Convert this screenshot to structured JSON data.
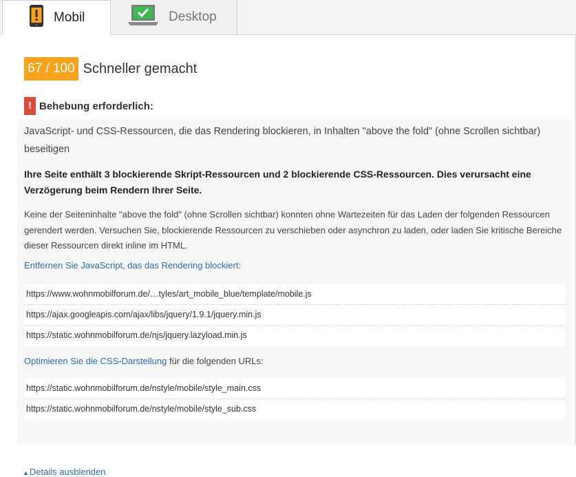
{
  "tabs": [
    {
      "label": "Mobil",
      "icon": "phone-warning-icon",
      "active": true
    },
    {
      "label": "Desktop",
      "icon": "laptop-check-icon",
      "active": false
    }
  ],
  "score": {
    "value": "67 / 100",
    "label": "Schneller gemacht",
    "color": "#f9a21c"
  },
  "fix": {
    "icon": "!",
    "title": "Behebung erforderlich:",
    "color": "#dd4b39"
  },
  "rule": {
    "title": "JavaScript- und CSS-Ressourcen, die das Rendering blockieren, in Inhalten \"above the fold\" (ohne Scrollen sichtbar) beseitigen",
    "summary": "Ihre Seite enthält 3 blockierende Skript-Ressourcen und 2 blockierende CSS-Ressourcen. Dies verursacht eine Verzögerung beim Rendern Ihrer Seite.",
    "description": "Keine der Seiteninhalte \"above the fold\" (ohne Scrollen sichtbar) konnten ohne Wartezeiten für das Laden der folgenden Ressourcen gerendert werden. Versuchen Sie, blockierende Ressourcen zu verschieben oder asynchron zu laden, oder laden Sie kritische Bereiche dieser Ressourcen direkt inline im HTML."
  },
  "js_section": {
    "link": "Entfernen Sie JavaScript, das das Rendering blockiert:",
    "urls": [
      "https://www.wohnmobilforum.de/…tyles/art_mobile_blue/template/mobile.js",
      "https://ajax.googleapis.com/ajax/libs/jquery/1.9.1/jquery.min.js",
      "https://static.wohnmobilforum.de/njs/jquery.lazyload.min.js"
    ]
  },
  "css_section": {
    "link": "Optimieren Sie die CSS-Darstellung",
    "suffix": " für die folgenden URLs:",
    "urls": [
      "https://static.wohnmobilforum.de/nstyle/mobile/style_main.css",
      "https://static.wohnmobilforum.de/nstyle/mobile/style_sub.css"
    ]
  },
  "details_toggle": {
    "arrow": "▲",
    "label": "Details ausblenden"
  },
  "colors": {
    "link": "#2a6cb8",
    "panel_bg": "#f7f7f7"
  }
}
